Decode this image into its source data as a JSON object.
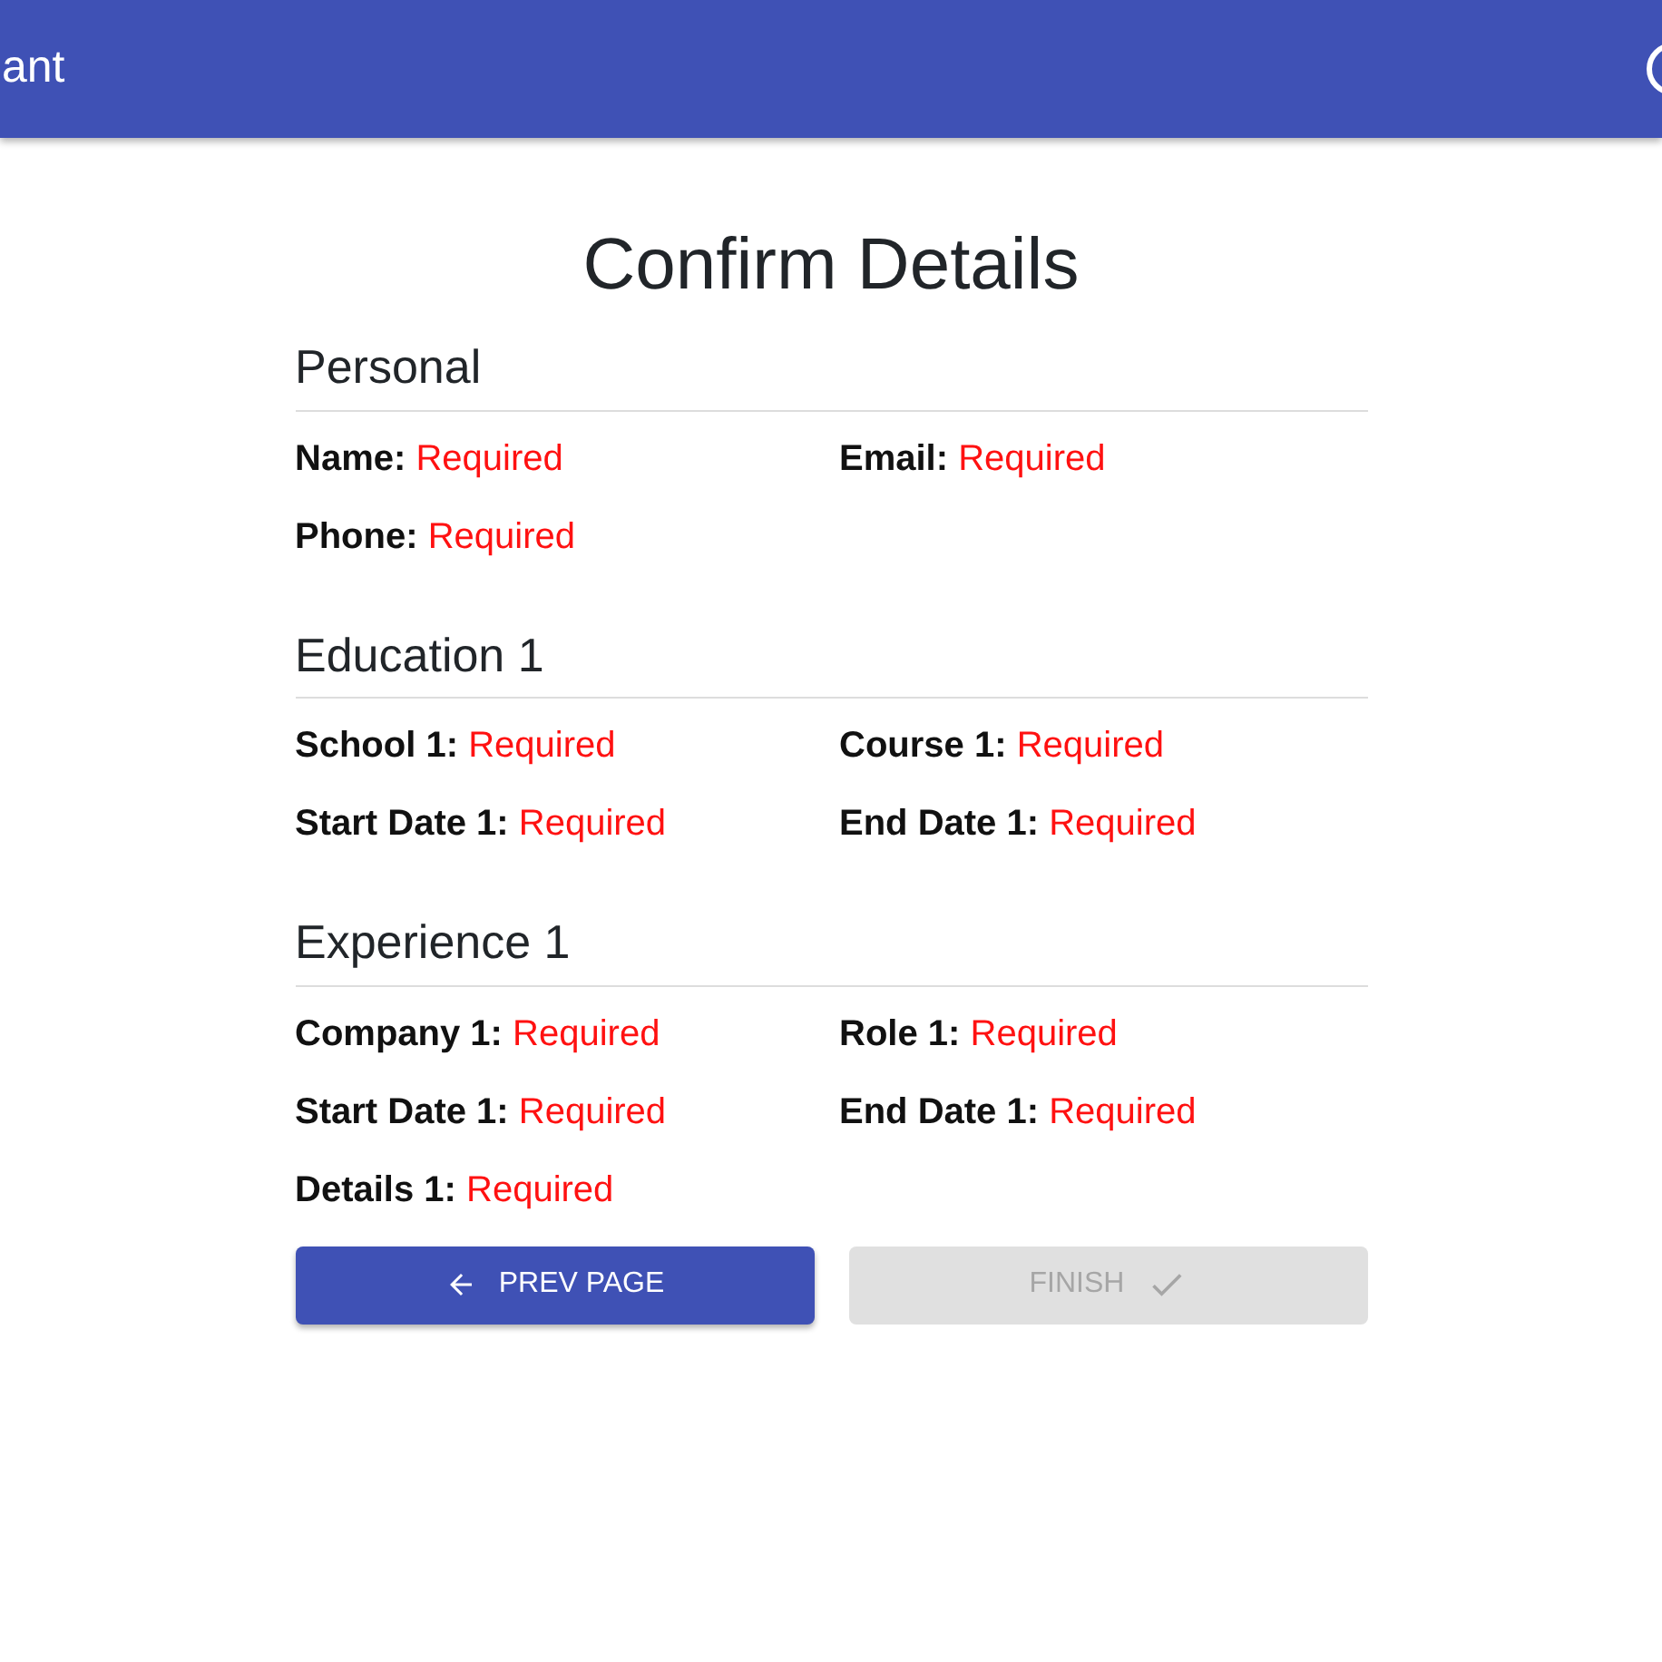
{
  "app_bar": {
    "title": "ant"
  },
  "page_title": "Confirm Details",
  "sections": [
    {
      "heading": "Personal",
      "fields": [
        {
          "label": "Name:",
          "value": "Required"
        },
        {
          "label": "Email:",
          "value": "Required"
        },
        {
          "label": "Phone:",
          "value": "Required"
        }
      ]
    },
    {
      "heading": "Education 1",
      "fields": [
        {
          "label": "School 1:",
          "value": "Required"
        },
        {
          "label": "Course 1:",
          "value": "Required"
        },
        {
          "label": "Start Date 1:",
          "value": "Required"
        },
        {
          "label": "End Date 1:",
          "value": "Required"
        }
      ]
    },
    {
      "heading": "Experience 1",
      "fields": [
        {
          "label": "Company 1:",
          "value": "Required"
        },
        {
          "label": "Role 1:",
          "value": "Required"
        },
        {
          "label": "Start Date 1:",
          "value": "Required"
        },
        {
          "label": "End Date 1:",
          "value": "Required"
        },
        {
          "label": "Details 1:",
          "value": "Required"
        }
      ]
    }
  ],
  "buttons": [
    {
      "kind": "prev",
      "label": "PREV PAGE",
      "disabled": false
    },
    {
      "kind": "finish",
      "label": "FINISH",
      "disabled": true
    }
  ]
}
